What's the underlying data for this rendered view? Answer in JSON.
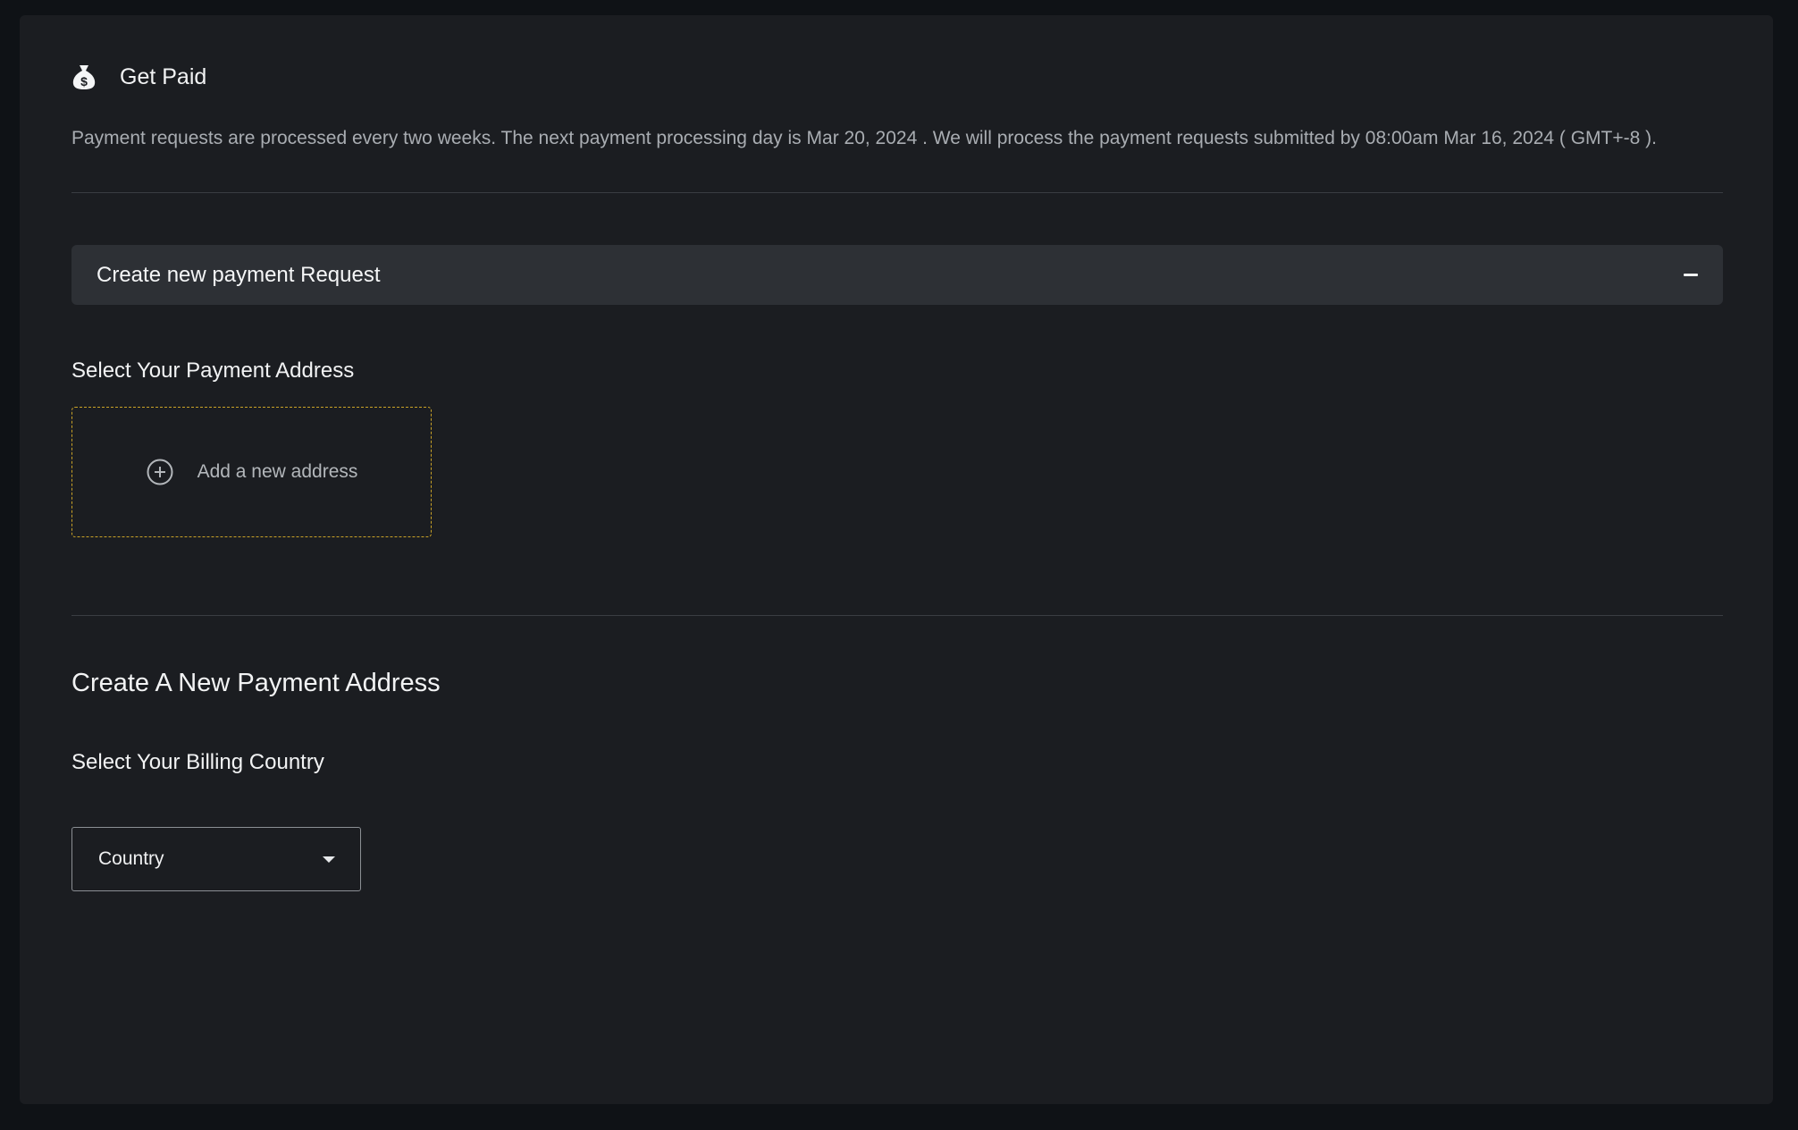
{
  "header": {
    "icon": "money-bag-icon",
    "title": "Get Paid"
  },
  "info": {
    "text": "Payment requests are processed every two weeks. The next payment processing day is Mar 20, 2024 . We will process the payment requests submitted by 08:00am Mar 16, 2024 ( GMT+-8 )."
  },
  "accordion": {
    "title": "Create new payment Request",
    "toggle_icon": "minus-icon",
    "expanded": true
  },
  "payment_address": {
    "label": "Select Your Payment Address",
    "add_icon": "plus-circle-icon",
    "add_label": "Add a new address"
  },
  "new_address": {
    "heading": "Create A New Payment Address",
    "billing_label": "Select Your Billing Country",
    "country_select": {
      "value": "Country",
      "icon": "caret-down-icon"
    }
  },
  "colors": {
    "background": "#0f1216",
    "panel": "#1b1d21",
    "accordion": "#2d3035",
    "dashed_border": "#c9a227",
    "text_primary": "#f2f3f4",
    "text_secondary": "#a9adb2"
  }
}
